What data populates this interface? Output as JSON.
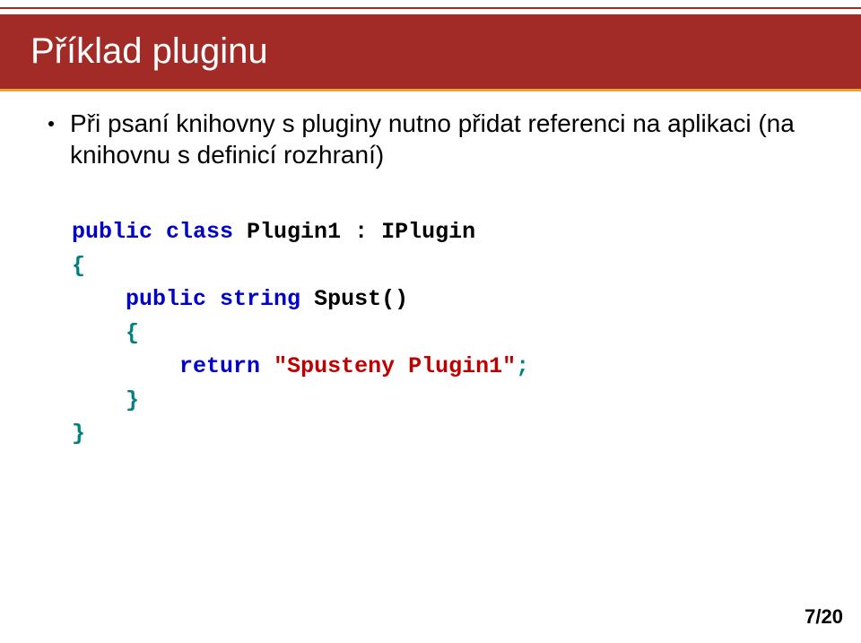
{
  "slide": {
    "title": "Příklad pluginu",
    "bullet": "Při psaní knihovny s pluginy nutno přidat referenci na aplikaci (na knihovnu s definicí rozhraní)",
    "code": {
      "kw_public1": "public",
      "kw_class": "class",
      "class_name": " Plugin1 : IPlugin",
      "brace_open1": "{",
      "kw_public2": "public",
      "kw_string": "string",
      "method_name": " Spust()",
      "brace_open2": "{",
      "kw_return": "return",
      "ret_space": " ",
      "ret_value": "\"Spusteny Plugin1\"",
      "semicolon": ";",
      "brace_close2": "}",
      "brace_close1": "}"
    },
    "page_number": "7/20"
  }
}
